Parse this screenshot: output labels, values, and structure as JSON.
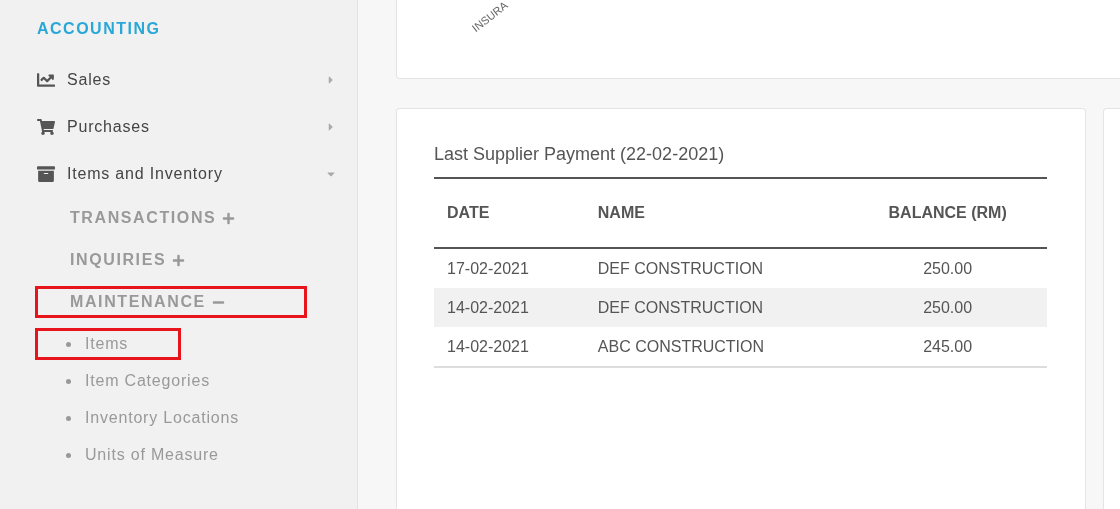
{
  "sidebar": {
    "heading": "ACCOUNTING",
    "items": [
      {
        "kind": "chart",
        "label": "Sales",
        "expanded": false
      },
      {
        "kind": "cart",
        "label": "Purchases",
        "expanded": false
      },
      {
        "kind": "archive",
        "label": "Items and Inventory",
        "expanded": true,
        "children": [
          {
            "label": "TRANSACTIONS",
            "expanded": false,
            "highlighted": false
          },
          {
            "label": "INQUIRIES",
            "expanded": false,
            "highlighted": false
          },
          {
            "label": "MAINTENANCE",
            "expanded": true,
            "highlighted": true,
            "children": [
              {
                "label": "Items",
                "highlighted": true
              },
              {
                "label": "Item Categories",
                "highlighted": false
              },
              {
                "label": "Inventory Locations",
                "highlighted": false
              },
              {
                "label": "Units of Measure",
                "highlighted": false
              }
            ]
          }
        ]
      }
    ]
  },
  "chart_card": {
    "axis_label": "INSURA"
  },
  "payment_card": {
    "title": "Last Supplier Payment (22-02-2021)",
    "table": {
      "columns": [
        "DATE",
        "NAME",
        "BALANCE (RM)"
      ],
      "rows": [
        [
          "17-02-2021",
          "DEF CONSTRUCTION",
          "250.00"
        ],
        [
          "14-02-2021",
          "DEF CONSTRUCTION",
          "250.00"
        ],
        [
          "14-02-2021",
          "ABC CONSTRUCTION",
          "245.00"
        ]
      ]
    }
  }
}
